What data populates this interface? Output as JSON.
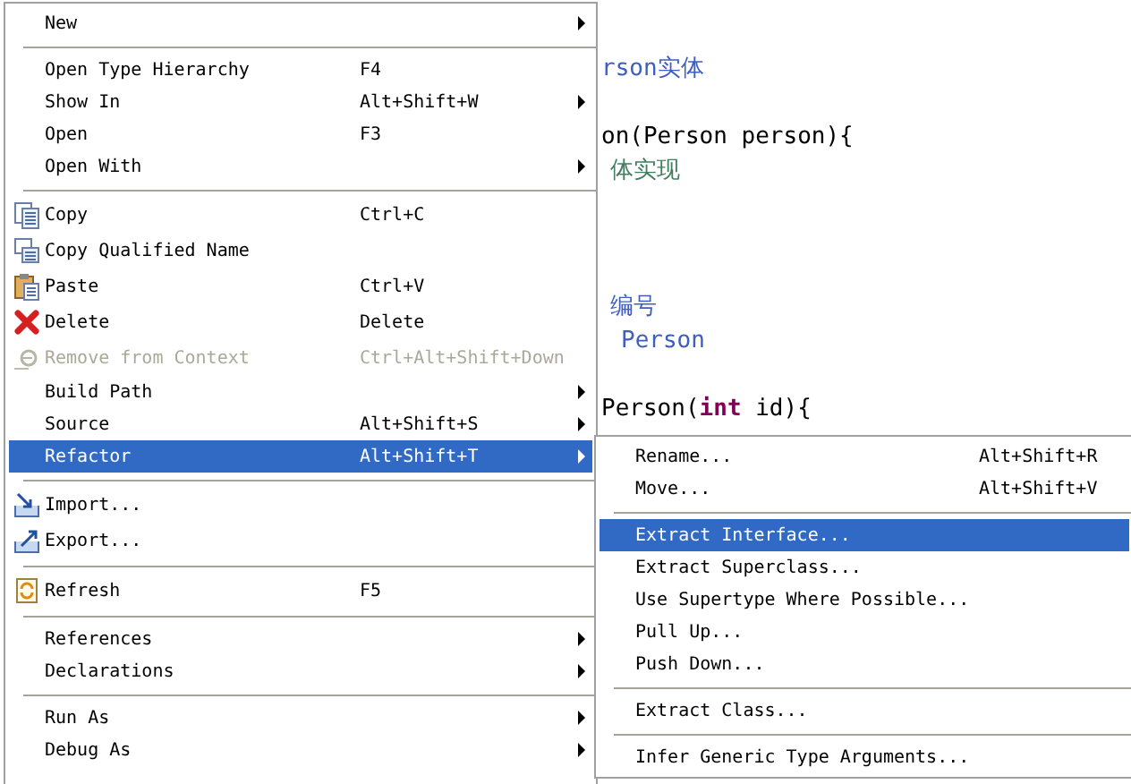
{
  "editor": {
    "lines": [
      {
        "segments": [
          {
            "kind": "doc",
            "text": "rson实体"
          }
        ]
      },
      {
        "segments": [
          {
            "kind": "plain",
            "text": "on(Person person){"
          }
        ]
      },
      {
        "segments": [
          {
            "kind": "comment",
            "text": "体实现"
          }
        ]
      },
      {
        "segments": [
          {
            "kind": "doc",
            "text": "编号"
          }
        ]
      },
      {
        "segments": [
          {
            "kind": "doc",
            "text": "Person"
          }
        ]
      },
      {
        "segments": [
          {
            "kind": "plain",
            "text": "Person("
          },
          {
            "kind": "keyword",
            "text": "int"
          },
          {
            "kind": "plain",
            "text": " id){"
          }
        ]
      }
    ]
  },
  "context_menu": {
    "groups": [
      [
        {
          "label": "New",
          "submenu": true,
          "selected": false,
          "disabled": false,
          "kind": "plain"
        }
      ],
      [
        {
          "label": "Open Type Hierarchy",
          "shortcut": "F4",
          "submenu": false,
          "selected": false,
          "disabled": false,
          "kind": "plain"
        },
        {
          "label": "Show In",
          "shortcut": "Alt+Shift+W",
          "submenu": true,
          "selected": false,
          "disabled": false,
          "kind": "plain"
        },
        {
          "label": "Open",
          "shortcut": "F3",
          "submenu": false,
          "selected": false,
          "disabled": false,
          "kind": "plain"
        },
        {
          "label": "Open With",
          "submenu": true,
          "selected": false,
          "disabled": false,
          "kind": "plain"
        }
      ],
      [
        {
          "label": "Copy",
          "shortcut": "Ctrl+C",
          "submenu": false,
          "selected": false,
          "disabled": false,
          "kind": "copy"
        },
        {
          "label": "Copy Qualified Name",
          "submenu": false,
          "selected": false,
          "disabled": false,
          "kind": "copyname"
        },
        {
          "label": "Paste",
          "shortcut": "Ctrl+V",
          "submenu": false,
          "selected": false,
          "disabled": false,
          "kind": "paste"
        },
        {
          "label": "Delete",
          "shortcut": "Delete",
          "submenu": false,
          "selected": false,
          "disabled": false,
          "kind": "delete"
        },
        {
          "label": "Remove from Context",
          "shortcut": "Ctrl+Alt+Shift+Down",
          "submenu": false,
          "selected": false,
          "disabled": true,
          "kind": "remove"
        },
        {
          "label": "Build Path",
          "submenu": true,
          "selected": false,
          "disabled": false,
          "kind": "plain"
        },
        {
          "label": "Source",
          "shortcut": "Alt+Shift+S",
          "submenu": true,
          "selected": false,
          "disabled": false,
          "kind": "plain"
        },
        {
          "label": "Refactor",
          "shortcut": "Alt+Shift+T",
          "submenu": true,
          "selected": true,
          "disabled": false,
          "kind": "plain"
        }
      ],
      [
        {
          "label": "Import...",
          "submenu": false,
          "selected": false,
          "disabled": false,
          "kind": "import"
        },
        {
          "label": "Export...",
          "submenu": false,
          "selected": false,
          "disabled": false,
          "kind": "export"
        }
      ],
      [
        {
          "label": "Refresh",
          "shortcut": "F5",
          "submenu": false,
          "selected": false,
          "disabled": false,
          "kind": "refresh"
        }
      ],
      [
        {
          "label": "References",
          "submenu": true,
          "selected": false,
          "disabled": false,
          "kind": "plain"
        },
        {
          "label": "Declarations",
          "submenu": true,
          "selected": false,
          "disabled": false,
          "kind": "plain"
        }
      ],
      [
        {
          "label": "Run As",
          "submenu": true,
          "selected": false,
          "disabled": false,
          "kind": "plain"
        },
        {
          "label": "Debug As",
          "submenu": true,
          "selected": false,
          "disabled": false,
          "kind": "plain"
        }
      ]
    ]
  },
  "refactor_submenu": {
    "groups": [
      [
        {
          "label": "Rename...",
          "shortcut": "Alt+Shift+R",
          "selected": false
        },
        {
          "label": "Move...",
          "shortcut": "Alt+Shift+V",
          "selected": false
        }
      ],
      [
        {
          "label": "Extract Interface...",
          "selected": true
        },
        {
          "label": "Extract Superclass...",
          "selected": false
        },
        {
          "label": "Use Supertype Where Possible...",
          "selected": false
        },
        {
          "label": "Pull Up...",
          "selected": false
        },
        {
          "label": "Push Down...",
          "selected": false
        }
      ],
      [
        {
          "label": "Extract Class...",
          "selected": false
        }
      ],
      [
        {
          "label": "Infer Generic Type Arguments...",
          "selected": false
        }
      ]
    ]
  }
}
